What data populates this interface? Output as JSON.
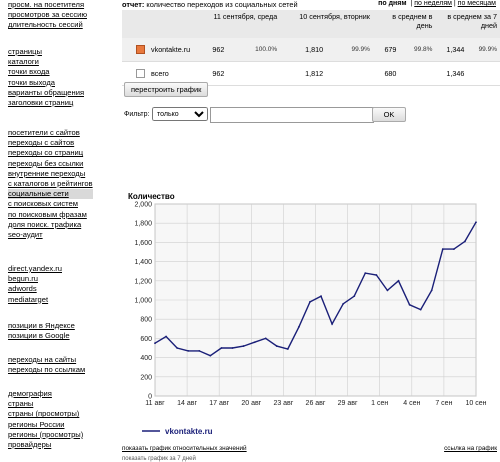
{
  "sidebar": {
    "groups": [
      [
        "просм. на посетителя",
        "просмотров за сессию",
        "длительность сессий"
      ],
      [
        "страницы",
        "каталоги",
        "точки входа",
        "точки выхода",
        "варианты обращения",
        "заголовки страниц"
      ],
      [
        "посетители с сайтов",
        "переходы с сайтов",
        "переходы со страниц",
        "переходы без ссылки",
        "внутренние переходы",
        "с каталогов и рейтингов",
        "социальные сети",
        "с поисковых систем",
        "по поисковым фразам",
        "доля поиск. трафика",
        "seo-аудит"
      ],
      [
        "direct.yandex.ru",
        "begun.ru",
        "adwords",
        "mediatarget"
      ],
      [
        "позиции в Яндексе",
        "позиции в Google"
      ],
      [
        "переходы на сайты",
        "переходы по ссылкам"
      ],
      [
        "демография",
        "страны",
        "страны (просмотры)",
        "регионы России",
        "регионы (просмотры)",
        "провайдеры"
      ]
    ],
    "active": "социальные сети"
  },
  "report": {
    "label": "отчет:",
    "title": "количество переходов из социальных сетей",
    "period_prefix": "по дням",
    "period_options": [
      "по неделям",
      "по месяцам"
    ]
  },
  "table": {
    "headers": [
      "11 сентября, среда",
      "10 сентября, вторник",
      "в среднем в день",
      "в среднем за 7 дней"
    ],
    "rows": [
      {
        "name": "vkontakte.ru",
        "checked": true,
        "d11": "962",
        "d11p": "100.0%",
        "d10": "1,810",
        "d10p": "99.9%",
        "avg": "679",
        "avgp": "99.8%",
        "avg7": "1,344",
        "avg7p": "99.9%"
      },
      {
        "name": "всего",
        "checked": false,
        "d11": "962",
        "d11p": "",
        "d10": "1,812",
        "d10p": "",
        "avg": "680",
        "avgp": "",
        "avg7": "1,346",
        "avg7p": ""
      }
    ]
  },
  "controls": {
    "redraw_label": "перестроить график",
    "filter_label": "Фильтр:",
    "filter_mode": "только",
    "filter_value": "",
    "ok_label": "OK"
  },
  "chart_data": {
    "type": "line",
    "title": "Количество",
    "x_ticks": [
      "11 авг",
      "14 авг",
      "17 авг",
      "20 авг",
      "23 авг",
      "26 авг",
      "29 авг",
      "1 сен",
      "4 сен",
      "7 сен",
      "10 сен"
    ],
    "ylim": [
      0,
      2000
    ],
    "y_ticks": [
      0,
      200,
      400,
      600,
      800,
      1000,
      1200,
      1400,
      1600,
      1800,
      2000
    ],
    "grid": true,
    "legend_position": "bottom-left",
    "series": [
      {
        "name": "vkontakte.ru",
        "color": "#1a1f78",
        "values": [
          550,
          620,
          500,
          470,
          470,
          420,
          500,
          500,
          520,
          560,
          600,
          520,
          490,
          720,
          980,
          1040,
          750,
          960,
          1040,
          1280,
          1260,
          1100,
          1200,
          950,
          900,
          1100,
          1530,
          1530,
          1610,
          1810
        ]
      }
    ]
  },
  "footer": {
    "relative_link": "показать график относительных значений",
    "link_chart": "ссылка на график",
    "cutoff_text": "показать график за 7 дней"
  }
}
